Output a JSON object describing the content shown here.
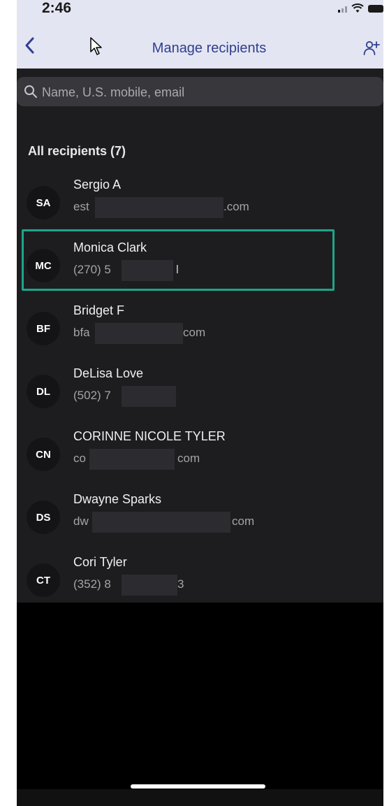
{
  "status_bar": {
    "time": "2:46"
  },
  "nav": {
    "title": "Manage recipients",
    "back_icon": "chevron-left-icon",
    "add_icon": "add-person-icon"
  },
  "search": {
    "placeholder": "Name, U.S. mobile, email",
    "value": ""
  },
  "section": {
    "label": "All recipients (7)"
  },
  "recipients": [
    {
      "initials": "SA",
      "name": "Sergio A",
      "detail_start": "est",
      "detail_end": ".com"
    },
    {
      "initials": "MC",
      "name": "Monica Clark",
      "detail_start": "(270) 5",
      "detail_end": "l"
    },
    {
      "initials": "BF",
      "name": "Bridget F",
      "detail_start": "bfa",
      "detail_end": "com"
    },
    {
      "initials": "DL",
      "name": "DeLisa Love",
      "detail_start": "(502) 7",
      "detail_end": ""
    },
    {
      "initials": "CN",
      "name": "CORINNE NICOLE TYLER",
      "detail_start": "co",
      "detail_end": "com"
    },
    {
      "initials": "DS",
      "name": "Dwayne Sparks",
      "detail_start": "dw",
      "detail_end": "com"
    },
    {
      "initials": "CT",
      "name": "Cori Tyler",
      "detail_start": "(352) 8",
      "detail_end": "3"
    }
  ],
  "colors": {
    "accent": "#2e3f8f",
    "highlight": "#1ea58a",
    "list_background": "#1d1d20"
  }
}
